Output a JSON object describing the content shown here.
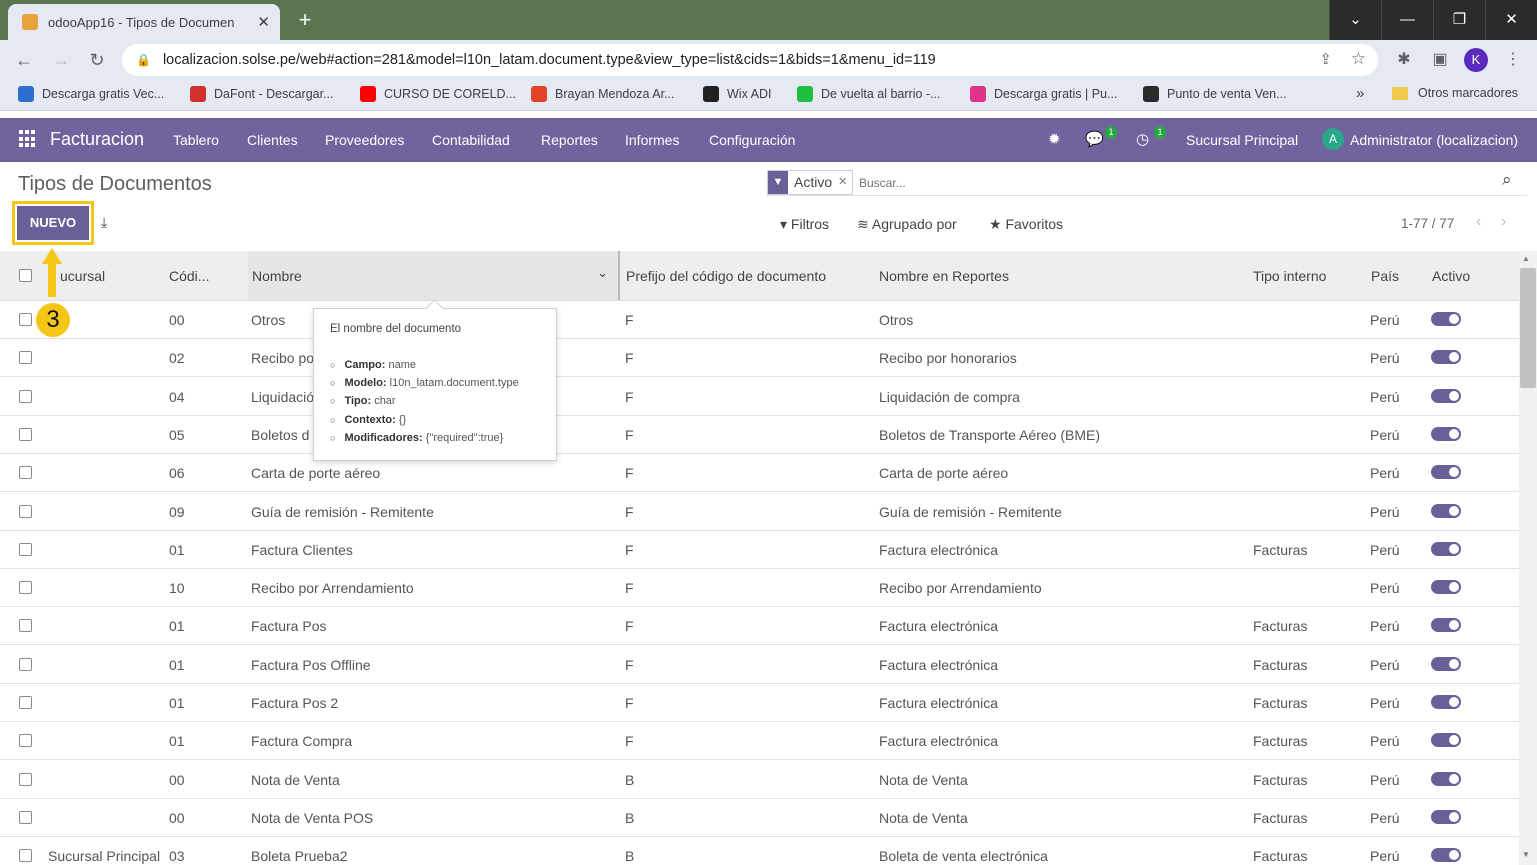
{
  "browser": {
    "tab_title": "odooApp16 - Tipos de Documen",
    "url": "localizacion.solse.pe/web#action=281&model=l10n_latam.document.type&view_type=list&cids=1&bids=1&menu_id=119",
    "profile_initial": "K",
    "bookmarks": [
      {
        "label": "Descarga gratis Vec...",
        "color": "#2c6fd1"
      },
      {
        "label": "DaFont - Descargar...",
        "color": "#d0312d"
      },
      {
        "label": "CURSO DE CORELD...",
        "color": "#ff0000"
      },
      {
        "label": "Brayan Mendoza Ar...",
        "color": "#e24329"
      },
      {
        "label": "Wix ADI",
        "color": "#222222"
      },
      {
        "label": "De vuelta al barrio -...",
        "color": "#1fbf3f"
      },
      {
        "label": "Descarga gratis | Pu...",
        "color": "#e0338a"
      },
      {
        "label": "Punto de venta Ven...",
        "color": "#2b2b2b"
      }
    ],
    "other_bookmarks": "Otros marcadores"
  },
  "navbar": {
    "app_name": "Facturacion",
    "menus": [
      "Tablero",
      "Clientes",
      "Proveedores",
      "Contabilidad",
      "Reportes",
      "Informes",
      "Configuración"
    ],
    "messages_count": "1",
    "activities_count": "1",
    "branch": "Sucursal Principal",
    "user_initial": "A",
    "user_name": "Administrator (localizacion)"
  },
  "control_panel": {
    "title": "Tipos de Documentos",
    "new_button": "NUEVO",
    "facet_value": "Activo",
    "search_placeholder": "Buscar...",
    "filters": "Filtros",
    "group_by": "Agrupado por",
    "favorites": "Favoritos",
    "pager": "1-77 / 77"
  },
  "table": {
    "headers": {
      "branch": "ucursal",
      "code": "Códi...",
      "name": "Nombre",
      "prefix": "Prefijo del código de documento",
      "report_name": "Nombre en Reportes",
      "internal_type": "Tipo interno",
      "country": "País",
      "active": "Activo"
    },
    "rows": [
      {
        "branch": "",
        "code": "00",
        "name": "Otros",
        "prefix": "F",
        "report_name": "Otros",
        "internal_type": "",
        "country": "Perú",
        "active": true
      },
      {
        "branch": "",
        "code": "02",
        "name": "Recibo po",
        "prefix": "F",
        "report_name": "Recibo por honorarios",
        "internal_type": "",
        "country": "Perú",
        "active": true
      },
      {
        "branch": "",
        "code": "04",
        "name": "Liquidació",
        "prefix": "F",
        "report_name": "Liquidación de compra",
        "internal_type": "",
        "country": "Perú",
        "active": true
      },
      {
        "branch": "",
        "code": "05",
        "name": "Boletos d",
        "prefix": "F",
        "report_name": "Boletos de Transporte Aéreo (BME)",
        "internal_type": "",
        "country": "Perú",
        "active": true
      },
      {
        "branch": "",
        "code": "06",
        "name": "Carta de porte aéreo",
        "prefix": "F",
        "report_name": "Carta de porte aéreo",
        "internal_type": "",
        "country": "Perú",
        "active": true
      },
      {
        "branch": "",
        "code": "09",
        "name": "Guía de remisión - Remitente",
        "prefix": "F",
        "report_name": "Guía de remisión - Remitente",
        "internal_type": "",
        "country": "Perú",
        "active": true
      },
      {
        "branch": "",
        "code": "01",
        "name": "Factura Clientes",
        "prefix": "F",
        "report_name": "Factura electrónica",
        "internal_type": "Facturas",
        "country": "Perú",
        "active": true
      },
      {
        "branch": "",
        "code": "10",
        "name": "Recibo por Arrendamiento",
        "prefix": "F",
        "report_name": "Recibo por Arrendamiento",
        "internal_type": "",
        "country": "Perú",
        "active": true
      },
      {
        "branch": "",
        "code": "01",
        "name": "Factura Pos",
        "prefix": "F",
        "report_name": "Factura electrónica",
        "internal_type": "Facturas",
        "country": "Perú",
        "active": true
      },
      {
        "branch": "",
        "code": "01",
        "name": "Factura Pos Offline",
        "prefix": "F",
        "report_name": "Factura electrónica",
        "internal_type": "Facturas",
        "country": "Perú",
        "active": true
      },
      {
        "branch": "",
        "code": "01",
        "name": "Factura Pos 2",
        "prefix": "F",
        "report_name": "Factura electrónica",
        "internal_type": "Facturas",
        "country": "Perú",
        "active": true
      },
      {
        "branch": "",
        "code": "01",
        "name": "Factura Compra",
        "prefix": "F",
        "report_name": "Factura electrónica",
        "internal_type": "Facturas",
        "country": "Perú",
        "active": true
      },
      {
        "branch": "",
        "code": "00",
        "name": "Nota de Venta",
        "prefix": "B",
        "report_name": "Nota de Venta",
        "internal_type": "Facturas",
        "country": "Perú",
        "active": true
      },
      {
        "branch": "",
        "code": "00",
        "name": "Nota de Venta POS",
        "prefix": "B",
        "report_name": "Nota de Venta",
        "internal_type": "Facturas",
        "country": "Perú",
        "active": true
      },
      {
        "branch": "Sucursal Principal",
        "code": "03",
        "name": "Boleta Prueba2",
        "prefix": "B",
        "report_name": "Boleta de venta electrónica",
        "internal_type": "Facturas",
        "country": "Perú",
        "active": true
      }
    ]
  },
  "tooltip": {
    "help": "El nombre del documento",
    "items": [
      {
        "label": "Campo:",
        "value": "name"
      },
      {
        "label": "Modelo:",
        "value": "l10n_latam.document.type"
      },
      {
        "label": "Tipo:",
        "value": "char"
      },
      {
        "label": "Contexto:",
        "value": "{}"
      },
      {
        "label": "Modificadores:",
        "value": "{\"required\":true}"
      }
    ]
  },
  "annotation": {
    "step_number": "3",
    "color": "#f5c518"
  }
}
